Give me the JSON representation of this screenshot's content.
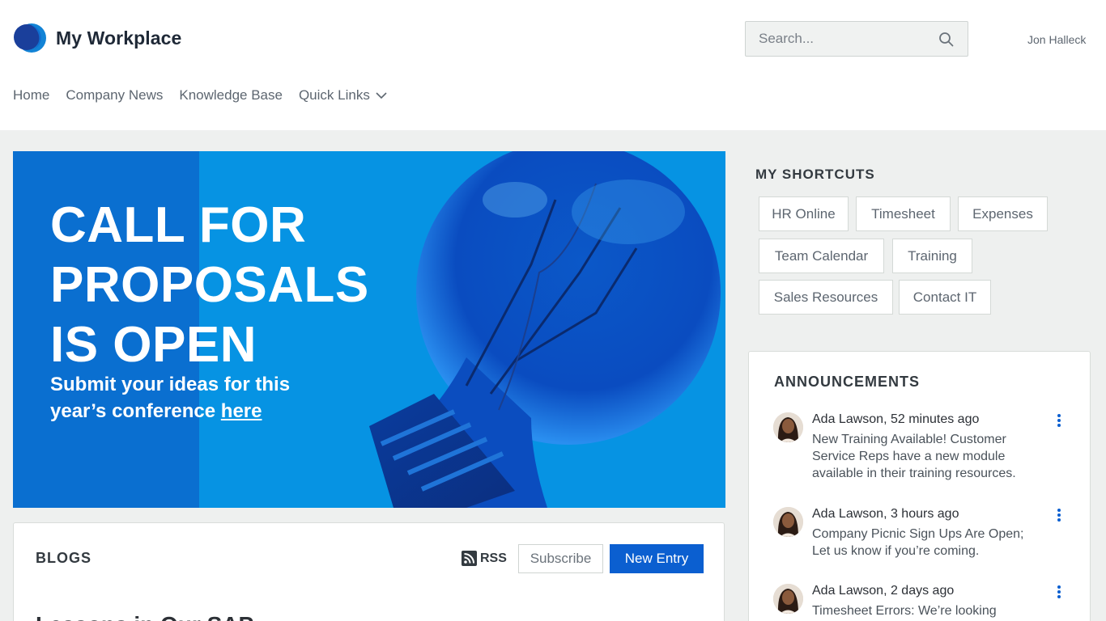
{
  "header": {
    "app_title": "My Workplace",
    "user_name": "Jon Halleck",
    "search": {
      "placeholder": "Search..."
    }
  },
  "nav": {
    "items": [
      {
        "label": "Home"
      },
      {
        "label": "Company News"
      },
      {
        "label": "Knowledge Base"
      },
      {
        "label": "Quick Links",
        "icon": "chevron-down-icon"
      }
    ]
  },
  "hero": {
    "title": "CALL FOR PROPOSALS IS OPEN",
    "subtitle": "Submit your ideas for this year’s conference",
    "link_text": "here"
  },
  "shortcuts": {
    "title": "MY SHORTCUTS",
    "items": [
      {
        "label": "HR Online"
      },
      {
        "label": "Timesheet"
      },
      {
        "label": "Expenses"
      },
      {
        "label": "Team Calendar"
      },
      {
        "label": "Training"
      },
      {
        "label": "Sales Resources"
      },
      {
        "label": "Contact IT"
      }
    ]
  },
  "announcements": {
    "title": "ANNOUNCEMENTS",
    "items": [
      {
        "author": "Ada Lawson, 52 minutes ago",
        "text": "New Training Available! Customer Service Reps have a new module available in their training resources."
      },
      {
        "author": "Ada Lawson, 3 hours ago",
        "text": "Company Picnic Sign Ups Are Open; Let us know if you’re coming."
      },
      {
        "author": "Ada Lawson, 2 days ago",
        "text": "Timesheet Errors: We’re looking"
      }
    ]
  },
  "blogs": {
    "title": "BLOGS",
    "rss_label": "RSS",
    "subscribe_label": "Subscribe",
    "new_entry_label": "New Entry",
    "entry_title_partial": "Lessons in Our SAP"
  },
  "colors": {
    "brand": "#0b5fd0",
    "hero_blue": "#0693e3",
    "page_bg": "#eef0ef"
  }
}
